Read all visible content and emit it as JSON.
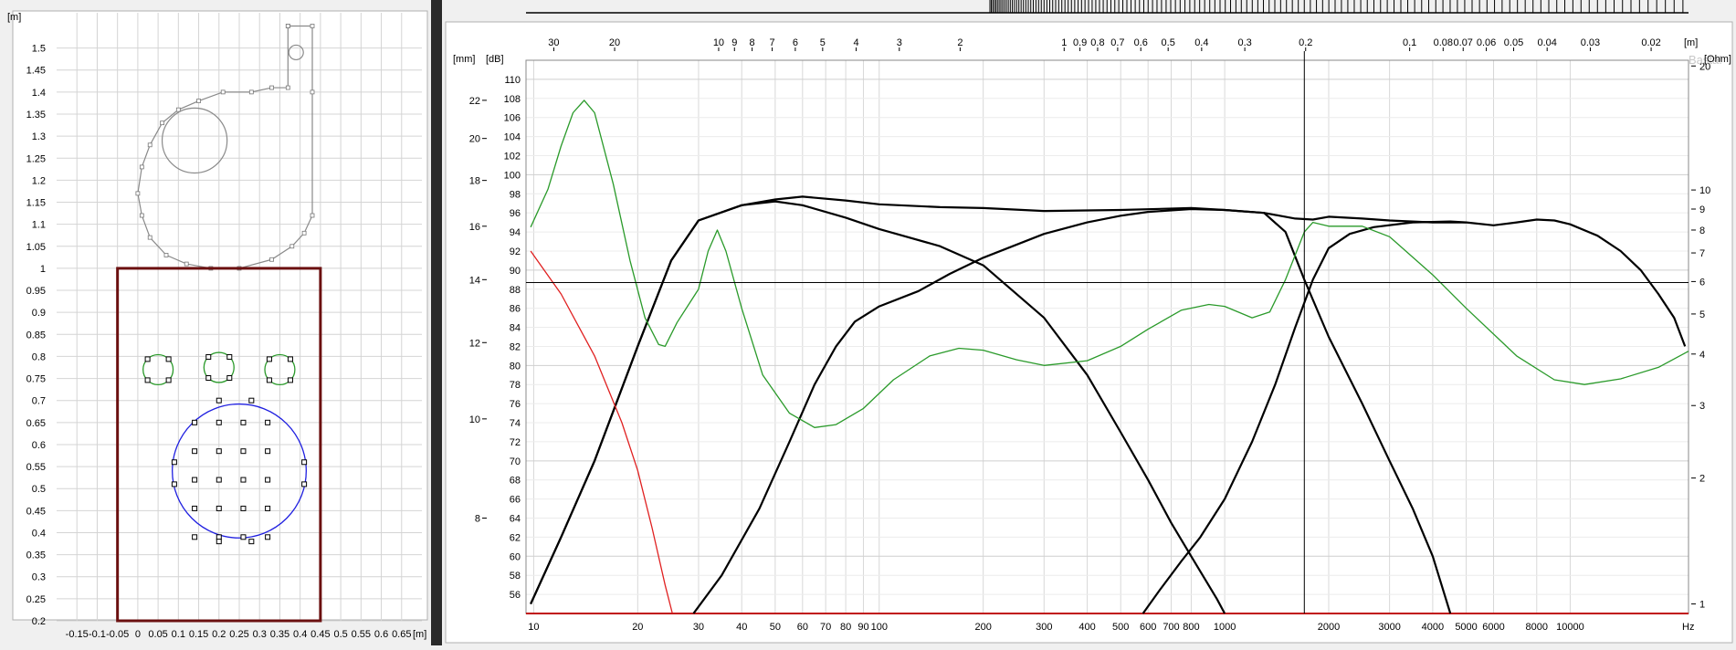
{
  "chart_data": [
    {
      "type": "diagram",
      "title": "",
      "y_unit": "[m]",
      "x_unit": "[m]",
      "x_ticks": [
        "-0.15",
        "-0.1",
        "-0.05",
        "0",
        "0.05",
        "0.1",
        "0.15",
        "0.2",
        "0.25",
        "0.3",
        "0.35",
        "0.4",
        "0.45",
        "0.5",
        "0.55",
        "0.6",
        "0.65"
      ],
      "x_values": [
        -0.15,
        -0.1,
        -0.05,
        0,
        0.05,
        0.1,
        0.15,
        0.2,
        0.25,
        0.3,
        0.35,
        0.4,
        0.45,
        0.5,
        0.55,
        0.6,
        0.65
      ],
      "y_ticks": [
        "0.2",
        "0.25",
        "0.3",
        "0.35",
        "0.4",
        "0.45",
        "0.5",
        "0.55",
        "0.6",
        "0.65",
        "0.7",
        "0.75",
        "0.8",
        "0.85",
        "0.9",
        "0.95",
        "1",
        "1.05",
        "1.1",
        "1.15",
        "1.2",
        "1.25",
        "1.3",
        "1.35",
        "1.4",
        "1.45",
        "1.5"
      ],
      "y_values": [
        0.2,
        0.25,
        0.3,
        0.35,
        0.4,
        0.45,
        0.5,
        0.55,
        0.6,
        0.65,
        0.7,
        0.75,
        0.8,
        0.85,
        0.9,
        0.95,
        1,
        1.05,
        1.1,
        1.15,
        1.2,
        1.25,
        1.3,
        1.35,
        1.4,
        1.45,
        1.5
      ],
      "xlim": [
        -0.2,
        0.7
      ],
      "ylim": [
        0.2,
        1.58
      ],
      "cabinet": {
        "x": [
          -0.05,
          0.45
        ],
        "y": [
          0.2,
          1.0
        ],
        "color": "#6b1010"
      },
      "tweeters": [
        {
          "cx": 0.05,
          "cy": 0.77,
          "r": 0.037
        },
        {
          "cx": 0.2,
          "cy": 0.775,
          "r": 0.037
        },
        {
          "cx": 0.35,
          "cy": 0.77,
          "r": 0.037
        }
      ],
      "woofer": {
        "cx": 0.25,
        "cy": 0.54,
        "r": 0.165,
        "color": "#2020e0"
      },
      "woofer_points": {
        "xs": [
          0.14,
          0.2,
          0.26,
          0.32
        ],
        "ys": [
          0.39,
          0.455,
          0.52,
          0.585,
          0.65
        ],
        "edge": [
          [
            0.2,
            0.7
          ],
          [
            0.28,
            0.7
          ],
          [
            0.2,
            0.38
          ],
          [
            0.28,
            0.38
          ],
          [
            0.09,
            0.56
          ],
          [
            0.09,
            0.51
          ],
          [
            0.41,
            0.56
          ],
          [
            0.41,
            0.51
          ]
        ]
      },
      "listener_circle": {
        "cx": 0.14,
        "cy": 1.29,
        "r": 0.08
      },
      "small_circle": {
        "cx": 0.39,
        "cy": 1.49,
        "r": 0.018
      },
      "outline": [
        [
          0.37,
          1.55
        ],
        [
          0.43,
          1.55
        ],
        [
          0.43,
          1.4
        ],
        [
          0.43,
          1.12
        ],
        [
          0.41,
          1.08
        ],
        [
          0.38,
          1.05
        ],
        [
          0.33,
          1.02
        ],
        [
          0.25,
          1.0
        ],
        [
          0.18,
          1.0
        ],
        [
          0.12,
          1.01
        ],
        [
          0.07,
          1.03
        ],
        [
          0.03,
          1.07
        ],
        [
          0.01,
          1.12
        ],
        [
          0.0,
          1.17
        ],
        [
          0.01,
          1.23
        ],
        [
          0.03,
          1.28
        ],
        [
          0.06,
          1.33
        ],
        [
          0.1,
          1.36
        ],
        [
          0.15,
          1.38
        ],
        [
          0.21,
          1.4
        ],
        [
          0.28,
          1.4
        ],
        [
          0.33,
          1.41
        ],
        [
          0.37,
          1.41
        ],
        [
          0.37,
          1.55
        ]
      ]
    },
    {
      "type": "line",
      "title": "",
      "watermark": "Basta!",
      "xlabel": "Hz",
      "x_scale": "log",
      "xlim": [
        9.5,
        22000
      ],
      "ylim": [
        54,
        112
      ],
      "x_ticks": [
        "10",
        "20",
        "30",
        "40",
        "50",
        "60",
        "70",
        "80",
        "90",
        "100",
        "200",
        "300",
        "400",
        "500",
        "600",
        "700",
        "800",
        "1000",
        "2000",
        "3000",
        "4000",
        "5000",
        "6000",
        "8000",
        "10000"
      ],
      "x_tick_values": [
        10,
        20,
        30,
        40,
        50,
        60,
        70,
        80,
        90,
        100,
        200,
        300,
        400,
        500,
        600,
        700,
        800,
        1000,
        2000,
        3000,
        4000,
        5000,
        6000,
        8000,
        10000
      ],
      "top_axis_unit": "[m]",
      "top_ticks": [
        "30",
        "20",
        "10",
        "9",
        "8",
        "7",
        "6",
        "5",
        "4",
        "3",
        "2",
        "1",
        "0.9",
        "0.8",
        "0.7",
        "0.6",
        "0.5",
        "0.4",
        "0.3",
        "0.2",
        "0.1",
        "0.08",
        "0.07",
        "0.06",
        "0.05",
        "0.04",
        "0.03",
        "0.02"
      ],
      "top_tick_values": [
        30,
        20,
        10,
        9,
        8,
        7,
        6,
        5,
        4,
        3,
        2,
        1,
        0.9,
        0.8,
        0.7,
        0.6,
        0.5,
        0.4,
        0.3,
        0.2,
        0.1,
        0.08,
        0.07,
        0.06,
        0.05,
        0.04,
        0.03,
        0.02
      ],
      "db_unit": "[dB]",
      "db_ticks": [
        "56",
        "58",
        "60",
        "62",
        "64",
        "66",
        "68",
        "70",
        "72",
        "74",
        "76",
        "78",
        "80",
        "82",
        "84",
        "86",
        "88",
        "90",
        "92",
        "94",
        "96",
        "98",
        "100",
        "102",
        "104",
        "106",
        "108",
        "110"
      ],
      "db_values": [
        56,
        58,
        60,
        62,
        64,
        66,
        68,
        70,
        72,
        74,
        76,
        78,
        80,
        82,
        84,
        86,
        88,
        90,
        92,
        94,
        96,
        98,
        100,
        102,
        104,
        106,
        108,
        110
      ],
      "mm_unit": "[mm]",
      "mm_ticks": [
        {
          "label": "8",
          "db": 64
        },
        {
          "label": "10",
          "db": 74.4
        },
        {
          "label": "12",
          "db": 82.4
        },
        {
          "label": "14",
          "db": 89
        },
        {
          "label": "16",
          "db": 94.6
        },
        {
          "label": "18",
          "db": 99.4
        },
        {
          "label": "20",
          "db": 103.8
        },
        {
          "label": "22",
          "db": 107.8
        }
      ],
      "ohm_unit": "[Ohm]",
      "ohm_ticks": [
        {
          "label": "1",
          "db": 55
        },
        {
          "label": "2",
          "db": 68.2
        },
        {
          "label": "3",
          "db": 75.8
        },
        {
          "label": "4",
          "db": 81.2
        },
        {
          "label": "5",
          "db": 85.4
        },
        {
          "label": "6",
          "db": 88.8
        },
        {
          "label": "7",
          "db": 91.8
        },
        {
          "label": "8",
          "db": 94.2
        },
        {
          "label": "9",
          "db": 96.4
        },
        {
          "label": "10",
          "db": 98.4
        },
        {
          "label": "20",
          "db": 111.4
        }
      ],
      "cursor": {
        "x": 1700,
        "y": 88.7
      },
      "series": [
        {
          "color": "#000000",
          "width": 2.2,
          "points": [
            [
              9.8,
              55
            ],
            [
              12,
              62
            ],
            [
              15,
              70
            ],
            [
              20,
              82
            ],
            [
              25,
              91
            ],
            [
              30,
              95.2
            ],
            [
              40,
              96.8
            ],
            [
              50,
              97.4
            ],
            [
              60,
              97.7
            ],
            [
              80,
              97.3
            ],
            [
              100,
              96.9
            ],
            [
              150,
              96.6
            ],
            [
              200,
              96.5
            ],
            [
              300,
              96.2
            ],
            [
              500,
              96.3
            ],
            [
              800,
              96.5
            ],
            [
              1000,
              96.3
            ],
            [
              1300,
              96
            ],
            [
              1600,
              95.4
            ],
            [
              1800,
              95.3
            ],
            [
              2000,
              95.6
            ],
            [
              2500,
              95.4
            ],
            [
              3000,
              95.2
            ],
            [
              4000,
              95
            ],
            [
              5000,
              95
            ],
            [
              6000,
              94.7
            ],
            [
              7000,
              95
            ],
            [
              8000,
              95.3
            ],
            [
              9000,
              95.2
            ],
            [
              10000,
              94.8
            ],
            [
              12000,
              93.6
            ],
            [
              14000,
              92
            ],
            [
              16000,
              90
            ],
            [
              18000,
              87.5
            ],
            [
              20000,
              85
            ],
            [
              21500,
              82
            ]
          ]
        },
        {
          "color": "#000000",
          "width": 2.2,
          "points": [
            [
              9.8,
              55
            ],
            [
              12,
              62
            ],
            [
              15,
              70
            ],
            [
              20,
              82
            ],
            [
              25,
              91
            ],
            [
              30,
              95.2
            ],
            [
              40,
              96.8
            ],
            [
              50,
              97.2
            ],
            [
              60,
              96.8
            ],
            [
              80,
              95.5
            ],
            [
              100,
              94.3
            ],
            [
              150,
              92.5
            ],
            [
              200,
              90.5
            ],
            [
              300,
              85
            ],
            [
              400,
              79
            ],
            [
              500,
              73
            ],
            [
              600,
              68
            ],
            [
              700,
              63.5
            ],
            [
              800,
              60
            ],
            [
              950,
              55.5
            ],
            [
              1000,
              54
            ]
          ]
        },
        {
          "color": "#000000",
          "width": 2.2,
          "points": [
            [
              29,
              54
            ],
            [
              35,
              58
            ],
            [
              45,
              65
            ],
            [
              55,
              72
            ],
            [
              65,
              78
            ],
            [
              75,
              82
            ],
            [
              85,
              84.6
            ],
            [
              100,
              86.2
            ],
            [
              130,
              87.8
            ],
            [
              160,
              89.6
            ],
            [
              200,
              91.3
            ],
            [
              300,
              93.8
            ],
            [
              400,
              95
            ],
            [
              500,
              95.7
            ],
            [
              600,
              96.1
            ],
            [
              800,
              96.4
            ],
            [
              1000,
              96.3
            ],
            [
              1300,
              96
            ],
            [
              1500,
              94
            ],
            [
              1700,
              89
            ],
            [
              2000,
              83
            ],
            [
              2500,
              76
            ],
            [
              3000,
              70
            ],
            [
              3500,
              65
            ],
            [
              4000,
              60
            ],
            [
              4500,
              54
            ]
          ]
        },
        {
          "color": "#000000",
          "width": 2.2,
          "points": [
            [
              580,
              54
            ],
            [
              650,
              56.5
            ],
            [
              750,
              59.5
            ],
            [
              850,
              62
            ],
            [
              1000,
              66
            ],
            [
              1200,
              72
            ],
            [
              1400,
              78
            ],
            [
              1600,
              84
            ],
            [
              1800,
              89
            ],
            [
              2000,
              92.3
            ],
            [
              2300,
              93.8
            ],
            [
              2700,
              94.5
            ],
            [
              3500,
              95
            ],
            [
              4500,
              95.1
            ],
            [
              5000,
              95
            ]
          ]
        },
        {
          "color": "#e02020",
          "width": 1.3,
          "points": [
            [
              9.8,
              92
            ],
            [
              12,
              87.5
            ],
            [
              15,
              81
            ],
            [
              18,
              74
            ],
            [
              20,
              69
            ],
            [
              22,
              63
            ],
            [
              24,
              57
            ],
            [
              25.2,
              54
            ]
          ]
        },
        {
          "color": "#2a9a2a",
          "width": 1.3,
          "points": [
            [
              9.8,
              94.5
            ],
            [
              11,
              98.5
            ],
            [
              12,
              103
            ],
            [
              13,
              106.5
            ],
            [
              14,
              107.8
            ],
            [
              15,
              106.5
            ],
            [
              17,
              99
            ],
            [
              19,
              91
            ],
            [
              21,
              85
            ],
            [
              23,
              82.2
            ],
            [
              24,
              82
            ],
            [
              26,
              84.5
            ],
            [
              30,
              88
            ],
            [
              32,
              92
            ],
            [
              34,
              94.2
            ],
            [
              36,
              92
            ],
            [
              40,
              86
            ],
            [
              46,
              79
            ],
            [
              55,
              75
            ],
            [
              65,
              73.5
            ],
            [
              75,
              73.8
            ],
            [
              90,
              75.5
            ],
            [
              110,
              78.5
            ],
            [
              140,
              81
            ],
            [
              170,
              81.8
            ],
            [
              200,
              81.6
            ],
            [
              250,
              80.6
            ],
            [
              300,
              80
            ],
            [
              400,
              80.5
            ],
            [
              500,
              82
            ],
            [
              600,
              83.8
            ],
            [
              750,
              85.8
            ],
            [
              900,
              86.4
            ],
            [
              1000,
              86.2
            ],
            [
              1200,
              85
            ],
            [
              1350,
              85.6
            ],
            [
              1500,
              89
            ],
            [
              1700,
              94
            ],
            [
              1800,
              95
            ],
            [
              2000,
              94.6
            ],
            [
              2500,
              94.6
            ],
            [
              3000,
              93.5
            ],
            [
              4000,
              89.5
            ],
            [
              5000,
              86
            ],
            [
              7000,
              81
            ],
            [
              9000,
              78.5
            ],
            [
              11000,
              78
            ],
            [
              14000,
              78.6
            ],
            [
              18000,
              79.8
            ],
            [
              22000,
              81.5
            ]
          ]
        }
      ]
    }
  ]
}
